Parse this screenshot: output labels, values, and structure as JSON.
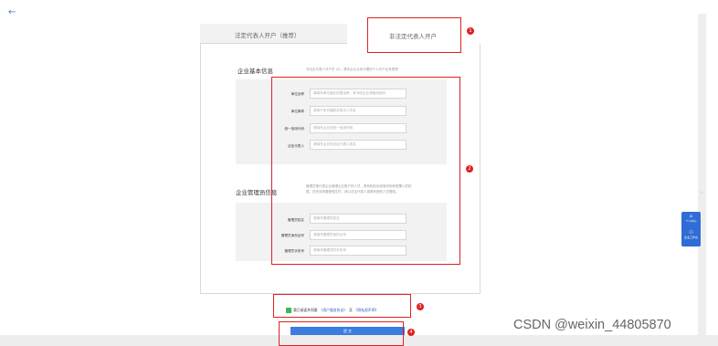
{
  "nav": {
    "back_glyph": "←"
  },
  "tabs": [
    {
      "label": "法定代表人开户（推荐）"
    },
    {
      "label": "非法定代表人开户"
    }
  ],
  "basic_info": {
    "title": "企业基本信息",
    "note": "非法定代表人开户员 (5)，是本企业业务代理的个人开户业务受理",
    "fields": [
      {
        "label": "单位全称",
        "placeholder": "请填写单位营业执照全称，有字段企业请使用括号"
      },
      {
        "label": "单位简称",
        "placeholder": "请用于系员通知并提示人员名"
      },
      {
        "label": "统一信用代码",
        "placeholder": "请填写企业的统一信用代码"
      },
      {
        "label": "法定代表人",
        "placeholder": "请填写企业的法定代表人姓名"
      }
    ]
  },
  "admin_info": {
    "title": "企业管理员信息",
    "note_line1": "管理员是代表企业管理企业账户的人员，具有相应系统操作权和签署人的权",
    "note_line2": "限，在完成掌握管理文件，请以法定代表人或具有授权人员登陆。",
    "fields": [
      {
        "label": "管理员姓名",
        "placeholder": "请填写管理员姓名"
      },
      {
        "label": "管理员身份证号",
        "placeholder": "请填写管理员身份证号"
      },
      {
        "label": "管理员手机号",
        "placeholder": "请填写管理员的手机号"
      }
    ]
  },
  "agreement": {
    "prefix": "我已阅读并同意",
    "link1": "《用户服务协议》",
    "joiner": "及",
    "link2": "《隐私权声明》"
  },
  "submit_label": "提 交",
  "annotations": [
    "1",
    "2",
    "3",
    "4"
  ],
  "side_buttons": [
    {
      "glyph": "⌂",
      "label": "个人中心"
    },
    {
      "glyph": "⚇",
      "label": "企业工作台"
    }
  ],
  "watermark": "CSDN @weixin_44805870",
  "colors": {
    "annotation_red": "#e02020",
    "primary_blue": "#3c7be0",
    "checkbox_green": "#3cba54"
  }
}
